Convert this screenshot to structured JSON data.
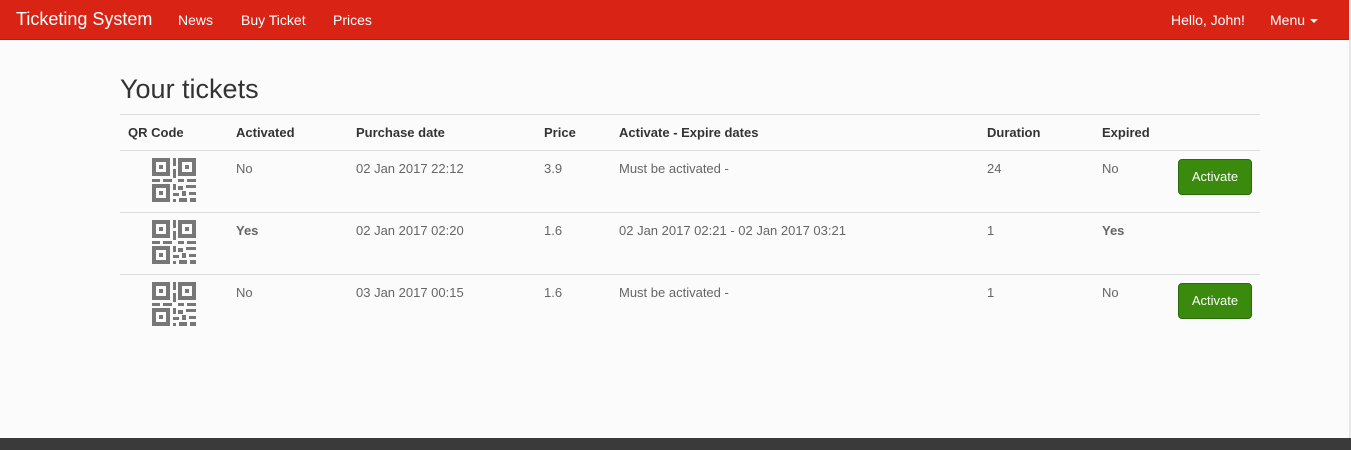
{
  "navbar": {
    "brand": "Ticketing System",
    "links": [
      "News",
      "Buy Ticket",
      "Prices"
    ],
    "greeting": "Hello, John!",
    "menu_label": "Menu"
  },
  "page": {
    "title": "Your tickets"
  },
  "table": {
    "columns": [
      "QR Code",
      "Activated",
      "Purchase date",
      "Price",
      "Activate - Expire dates",
      "Duration",
      "Expired",
      ""
    ],
    "rows": [
      {
        "activated": "No",
        "purchase_date": "02 Jan 2017 22:12",
        "price": "3.9",
        "dates": "Must be activated -",
        "duration": "24",
        "expired": "No",
        "action": "Activate"
      },
      {
        "activated": "Yes",
        "purchase_date": "02 Jan 2017 02:20",
        "price": "1.6",
        "dates": "02 Jan 2017 02:21 - 02 Jan 2017 03:21",
        "duration": "1",
        "expired": "Yes",
        "action": ""
      },
      {
        "activated": "No",
        "purchase_date": "03 Jan 2017 00:15",
        "price": "1.6",
        "dates": "Must be activated -",
        "duration": "1",
        "expired": "No",
        "action": "Activate"
      }
    ]
  },
  "colors": {
    "navbar": "#d92314",
    "activate_button": "#3a8a0e",
    "yes_green": "#3b7d1f",
    "yes_red": "#cc1f0f",
    "footer": "#3a3a3a"
  },
  "icons": {
    "qr": "qr-code-icon",
    "menu_caret": "caret-down-icon"
  }
}
